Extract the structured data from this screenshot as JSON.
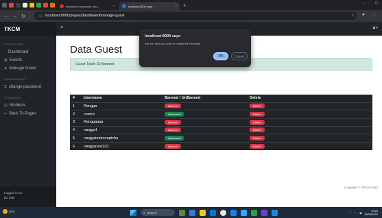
{
  "browser": {
    "tabs": [
      {
        "title": "Indonesia Kampanye Ideo...",
        "active": false,
        "color": "#c6312c"
      },
      {
        "title": "localhost:8000 saya",
        "active": true,
        "color": "#1a73e8"
      }
    ],
    "url": "localhost:8000/pages/dashboard/manage-guest"
  },
  "sidebar": {
    "brand": "TKCM",
    "sections": [
      {
        "heading": "DASHBOARD",
        "items": [
          {
            "label": "Dashboard",
            "icon": "gauge-icon"
          },
          {
            "label": "Events",
            "icon": "calendar-icon"
          },
          {
            "label": "Manage Guest",
            "icon": "users-icon"
          }
        ]
      },
      {
        "heading": "MANAGEMENT",
        "items": [
          {
            "label": "change password",
            "icon": "key-icon"
          }
        ]
      },
      {
        "heading": "STUDENTS",
        "items": [
          {
            "label": "Students",
            "icon": "table-icon"
          },
          {
            "label": "Back To Pages",
            "icon": "arrow-left-icon"
          }
        ]
      }
    ],
    "footer_line1": "Logged in as:",
    "footer_line2": "Ilia Mile"
  },
  "main": {
    "title": "Data Guest",
    "alert": "Guest Telah Di Banned",
    "table": {
      "headers": [
        "#",
        "Username",
        "Banned / UnBanned",
        "Delete"
      ],
      "rows": [
        {
          "no": "1",
          "username": "Rangga",
          "status": "Banned",
          "status_color": "#dc3545",
          "delete": "Delete"
        },
        {
          "no": "2",
          "username": "costco",
          "status": "Unbanned",
          "status_color": "#198754",
          "delete": "Delete"
        },
        {
          "no": "3",
          "username": "Ranggaaaa",
          "status": "Banned",
          "status_color": "#dc3545",
          "delete": "Delete"
        },
        {
          "no": "4",
          "username": "rangga1",
          "status": "Banned",
          "status_color": "#dc3545",
          "delete": "Delete"
        },
        {
          "no": "5",
          "username": "ranggatestrecaptcha",
          "status": "Unbanned",
          "status_color": "#198754",
          "delete": "Delete"
        },
        {
          "no": "6",
          "username": "ranggarara123",
          "status": "Banned",
          "status_color": "#dc3545",
          "delete": "Delete"
        }
      ]
    },
    "copyright": "Copyright © TKCM 2022"
  },
  "dialog": {
    "title": "localhost:8000 says",
    "message": "Are you sure you want to unbanned this guest",
    "ok": "OK",
    "cancel": "Cancel"
  },
  "taskbar": {
    "weather": "26°C",
    "search": "Search",
    "time": "10:26",
    "date": "13/09/2022"
  }
}
